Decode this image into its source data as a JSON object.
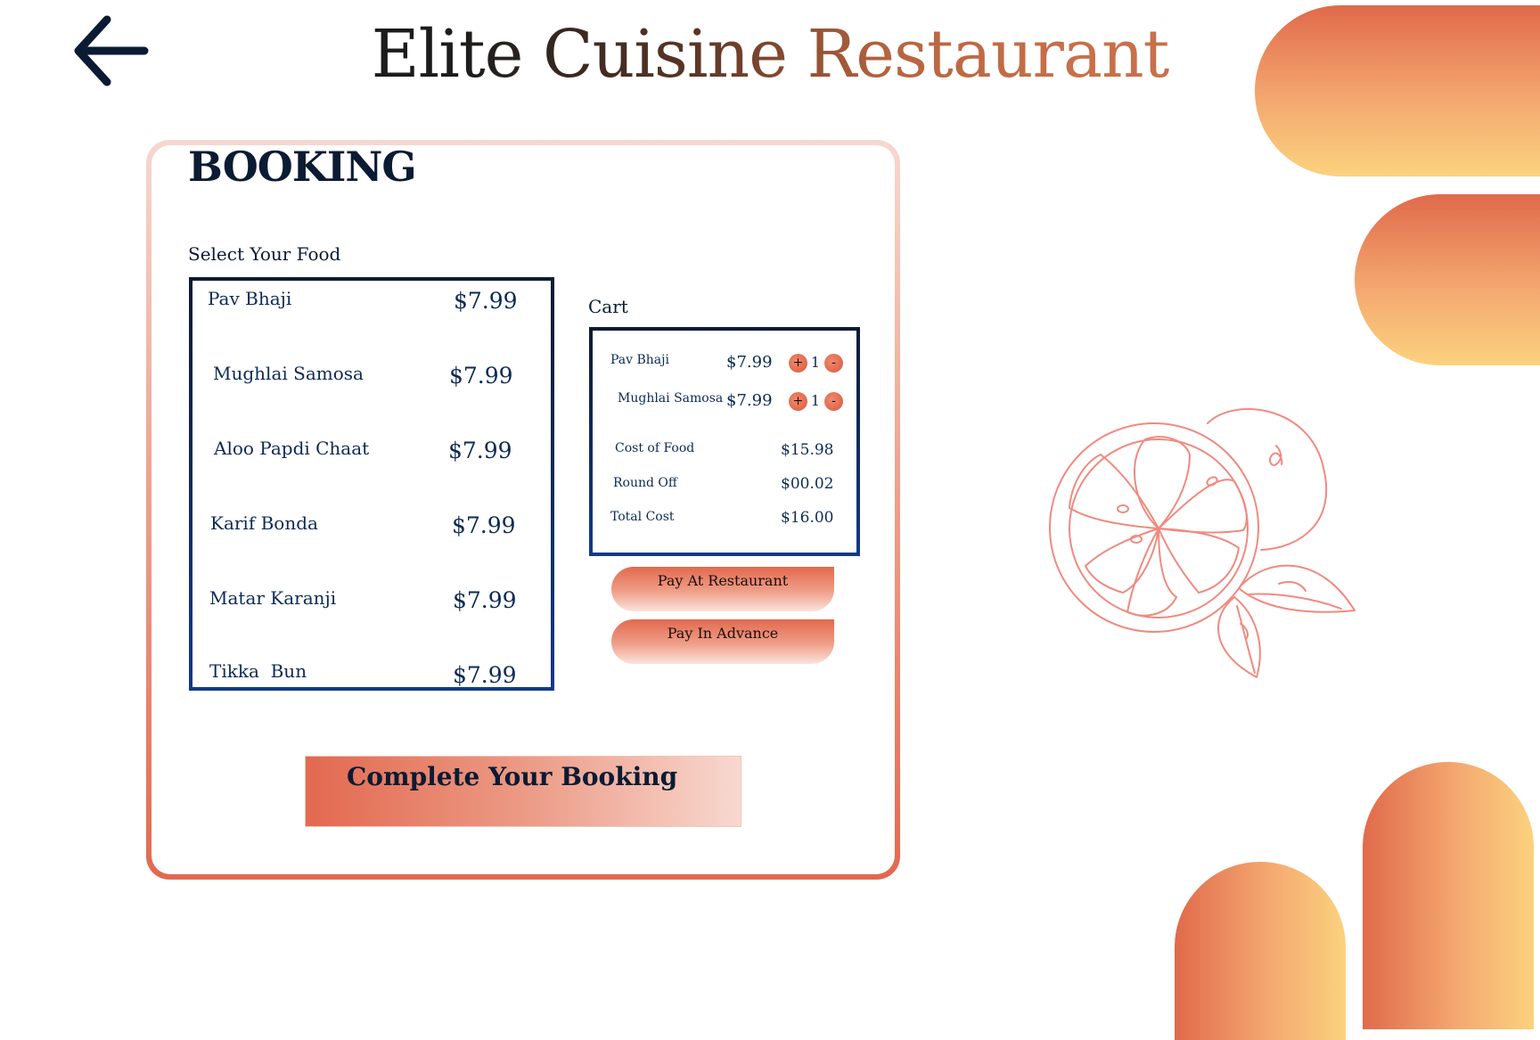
{
  "header": {
    "title": "Elite Cuisine Restaurant",
    "back_icon": "arrow-left-icon"
  },
  "booking": {
    "title": "BOOKING",
    "select_label": "Select Your Food",
    "menu": [
      {
        "name": "Pav Bhaji",
        "price": "$7.99"
      },
      {
        "name": "Mughlai Samosa",
        "price": "$7.99"
      },
      {
        "name": "Aloo Papdi Chaat",
        "price": "$7.99"
      },
      {
        "name": "Karif Bonda",
        "price": "$7.99"
      },
      {
        "name": "Matar Karanji",
        "price": "$7.99"
      },
      {
        "name": "Tikka  Bun",
        "price": "$7.99"
      }
    ],
    "cart": {
      "label": "Cart",
      "items": [
        {
          "name": "Pav Bhaji",
          "price": "$7.99",
          "plus": "+",
          "qty": "1",
          "minus": "-"
        },
        {
          "name": "Mughlai Samosa",
          "price": "$7.99",
          "plus": "+",
          "qty": "1",
          "minus": "-"
        }
      ],
      "summary": [
        {
          "label": "Cost of Food",
          "value": "$15.98"
        },
        {
          "label": "Round Off",
          "value": "$00.02"
        },
        {
          "label": "Total Cost",
          "value": "$16.00"
        }
      ]
    },
    "pay_at_restaurant": "Pay At Restaurant",
    "pay_in_advance": "Pay In Advance",
    "complete_button": "Complete Your Booking"
  },
  "decor": {
    "illustration": "orange-fruit-line-art",
    "colors": {
      "accent": "#e2694f",
      "gold": "#fbd27e",
      "navy": "#0d2a55",
      "line": "#f08a80"
    }
  }
}
